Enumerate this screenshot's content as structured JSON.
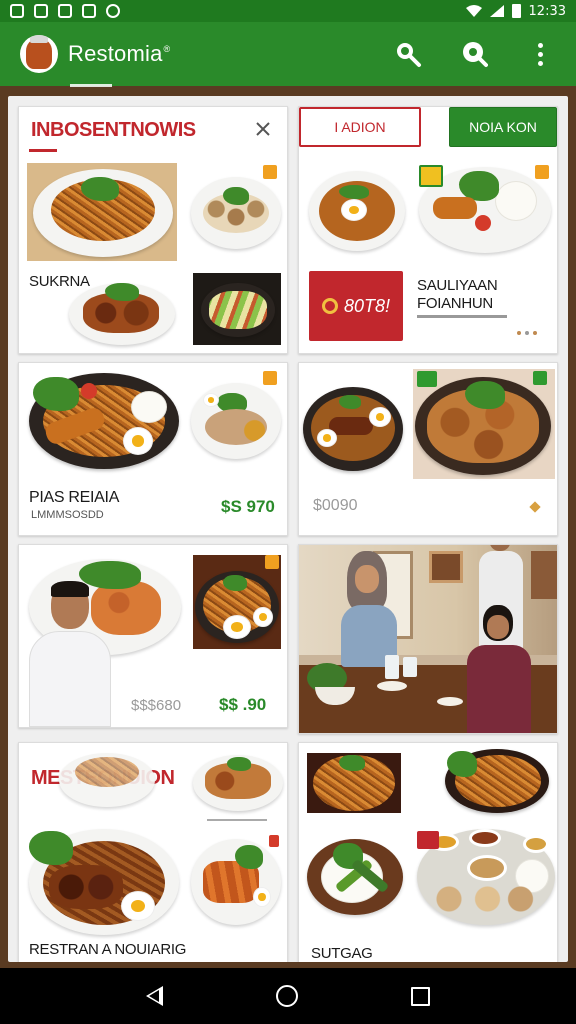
{
  "status_bar": {
    "time": "12:33"
  },
  "app_bar": {
    "title": "Restomia",
    "title_mark": "®",
    "actions": [
      "search-icon",
      "search-alt-icon",
      "more-vert-icon"
    ]
  },
  "colors": {
    "primary": "#2a8a2a",
    "accent_red": "#c1272d",
    "price_green": "#2a8a2a"
  },
  "cards": {
    "c1": {
      "heading": "INBOSENTNOWIS",
      "label": "SUKRNA",
      "close_icon": "close-icon"
    },
    "c2": {
      "button_outline": "I ADION",
      "button_green": "NOIA KON",
      "banner_text": "80T8!",
      "title_line1": "SAULIYAAN",
      "title_line2": "FOIANHUN"
    },
    "c3": {
      "title": "PIAS REIAIA",
      "subtitle": "LMMMSOSDD",
      "price": "$S 970"
    },
    "c4": {
      "price": "$0090"
    },
    "c5": {
      "price_gray": "$$$680",
      "price_green": "$$ .90"
    },
    "c7": {
      "heading": "MESTEONUION",
      "label": "RESTRAN A NOUIARIG"
    },
    "c8": {
      "label": "SUTGAG"
    }
  },
  "nav": {
    "icons": [
      "back-icon",
      "home-icon",
      "recents-icon"
    ]
  }
}
